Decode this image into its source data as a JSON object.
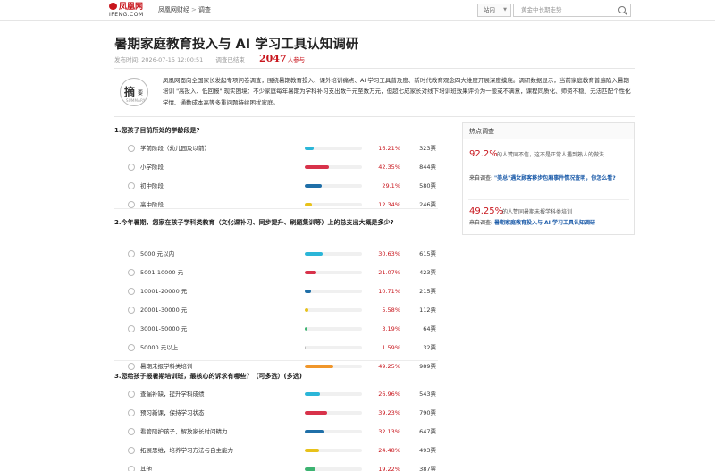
{
  "header": {
    "logo_cn": "凤凰网",
    "logo_en": "IFENG.COM",
    "breadcrumb": [
      "凤凰网财经",
      "调查"
    ],
    "scope_select": "站内",
    "search_placeholder": "黄金中长期走势"
  },
  "article": {
    "title": "暑期家庭教育投入与 AI 学习工具认知调研",
    "publish_label": "发布时间:",
    "publish_time": "2026-07-15 12:00:51",
    "status": "调查已结束",
    "participants": "2047",
    "participants_suffix": "人参与",
    "badge_main": "摘",
    "badge_sub": "要",
    "badge_en": "SUMMARY",
    "summary": "凤凰网面向全国家长发起专项问卷调查，围绕暑期教育投入、课外培训痛点、AI 学习工具普及度、新时代教育观念四大维度开展深度摸底。调研数据显示，当前家庭教育普遍陷入暑期培训 \"高投入、低回报\" 现实困境：不少家庭每年暑期为学科补习支出数千元至数万元，但超七成家长对线下培训班效果评价为一般或不满意，课程同质化、师资不稳、无法匹配个性化学情、通勤成本高等多重问题持续困扰家庭。"
  },
  "questions": [
    {
      "title": "1.您孩子目前所处的学龄段是?",
      "options": [
        {
          "label": "学前阶段（幼儿园及以前）",
          "pct": "16.21%",
          "value": 16.21,
          "votes": "323票",
          "color": "#2bb6d8"
        },
        {
          "label": "小学阶段",
          "pct": "42.35%",
          "value": 42.35,
          "votes": "844票",
          "color": "#d8324a"
        },
        {
          "label": "初中阶段",
          "pct": "29.1%",
          "value": 29.1,
          "votes": "580票",
          "color": "#1f6fa8"
        },
        {
          "label": "高中阶段",
          "pct": "12.34%",
          "value": 12.34,
          "votes": "246票",
          "color": "#e8c21a"
        }
      ]
    },
    {
      "title": "2.今年暑期，您家在孩子学科类教育（文化课补习、同步提升、刷题集训等）上的总支出大概是多少?",
      "options": [
        {
          "label": "5000 元以内",
          "pct": "30.63%",
          "value": 30.63,
          "votes": "615票",
          "color": "#2bb6d8"
        },
        {
          "label": "5001-10000 元",
          "pct": "21.07%",
          "value": 21.07,
          "votes": "423票",
          "color": "#d8324a"
        },
        {
          "label": "10001-20000 元",
          "pct": "10.71%",
          "value": 10.71,
          "votes": "215票",
          "color": "#1f6fa8"
        },
        {
          "label": "20001-30000 元",
          "pct": "5.58%",
          "value": 5.58,
          "votes": "112票",
          "color": "#e8c21a"
        },
        {
          "label": "30001-50000 元",
          "pct": "3.19%",
          "value": 3.19,
          "votes": "64票",
          "color": "#3cb371"
        },
        {
          "label": "50000 元以上",
          "pct": "1.59%",
          "value": 1.59,
          "votes": "32票",
          "color": "#bbbbbb"
        },
        {
          "label": "暑期未报学科类培训",
          "pct": "49.25%",
          "value": 49.25,
          "votes": "989票",
          "color": "#f0962a"
        }
      ]
    },
    {
      "title": "3.您给孩子报暑期培训班，最核心的诉求有哪些？（可多选）(多选)",
      "options": [
        {
          "label": "查漏补缺，提升学科成绩",
          "pct": "26.96%",
          "value": 26.96,
          "votes": "543票",
          "color": "#2bb6d8"
        },
        {
          "label": "预习新课，保持学习状态",
          "pct": "39.23%",
          "value": 39.23,
          "votes": "790票",
          "color": "#d8324a"
        },
        {
          "label": "看管陪护孩子，解放家长时间精力",
          "pct": "32.13%",
          "value": 32.13,
          "votes": "647票",
          "color": "#1f6fa8"
        },
        {
          "label": "拓展思维，培养学习方法与自主能力",
          "pct": "24.48%",
          "value": 24.48,
          "votes": "493票",
          "color": "#e8c21a"
        },
        {
          "label": "其他",
          "pct": "19.22%",
          "value": 19.22,
          "votes": "387票",
          "color": "#3cb371"
        }
      ]
    }
  ],
  "sidebar": {
    "title": "热点调查",
    "items": [
      {
        "pct": "92.2%",
        "text": "的人赞同不信，这不是正常人遇到熟人的做法",
        "src_label": "来自调查:",
        "src_title": "\"美总\"遇女顾客移步包厢事件情况查明，你怎么看?"
      },
      {
        "pct": "49.25%",
        "text": "的人赞同暑期未报学科类培训",
        "src_label": "来自调查:",
        "src_title": "暑期家庭教育投入与 AI 学习工具认知调研"
      }
    ]
  }
}
